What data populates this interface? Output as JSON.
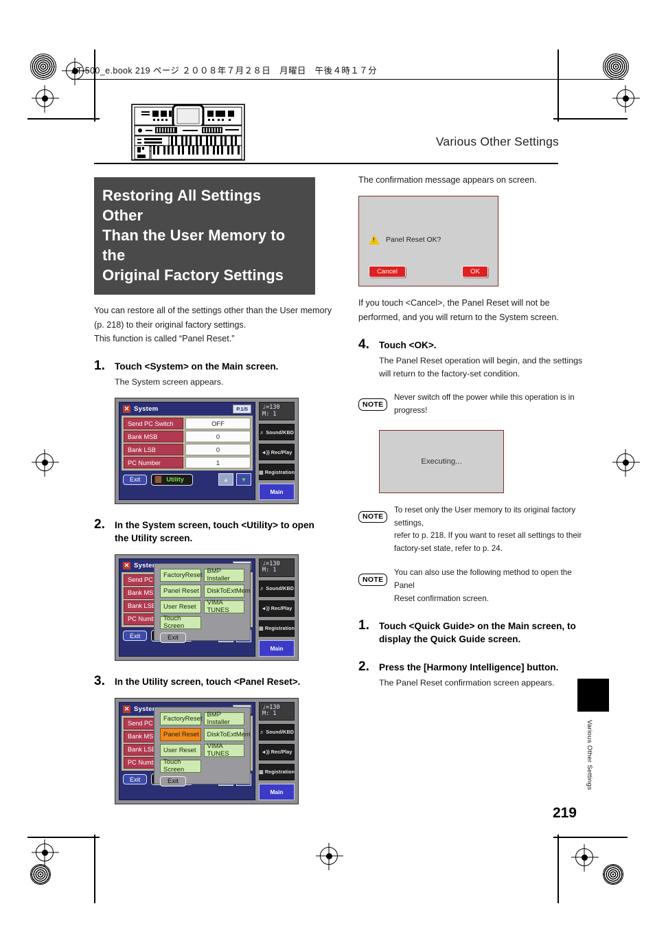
{
  "print_header": {
    "book_line": "AT-500_e.book 219 ページ ２００８年７月２８日　月曜日　午後４時１７分"
  },
  "running_header": {
    "section": "Various Other Settings"
  },
  "illustration": {
    "name": "at-500-organ-front-panel"
  },
  "title": {
    "line1": "Restoring All Settings Other",
    "line2": "Than the User Memory to the",
    "line3": "Original Factory Settings"
  },
  "lead": {
    "l1": "You can restore all of the settings other than the User memory",
    "l2": "(p. 218) to their original factory settings.",
    "l3": "This function is called “Panel Reset.”"
  },
  "steps_left": [
    {
      "num": "1.",
      "head": "Touch <System> on the Main screen.",
      "sub": "The System screen appears."
    },
    {
      "num": "2.",
      "head": "In the System screen, touch <Utility> to open the Utility screen.",
      "sub": ""
    },
    {
      "num": "3.",
      "head": "In the Utility screen, touch <Panel Reset>.",
      "sub": ""
    }
  ],
  "system_screen": {
    "title": "System",
    "close_label": "✕",
    "page_indicator": "P.1/5",
    "rows": [
      {
        "label": "Send PC Switch",
        "value": "OFF"
      },
      {
        "label": "Bank MSB",
        "value": "0"
      },
      {
        "label": "Bank LSB",
        "value": "0"
      },
      {
        "label": "PC Number",
        "value": "1"
      }
    ],
    "exit_label": "Exit",
    "utility_label": "Utility",
    "arrow_up": "▲",
    "arrow_down": "▼"
  },
  "side_panel": {
    "tempo": "♩=130",
    "measure": "M:    1",
    "buttons": [
      {
        "label": "Sound/KBD",
        "icon": "note-icon"
      },
      {
        "label": "Rec/Play",
        "icon": "speaker-icon"
      },
      {
        "label": "Registration",
        "icon": "registration-icon"
      }
    ],
    "main_label": "Main"
  },
  "utility_popup": {
    "buttons": [
      "FactoryReset",
      "BMP Installer",
      "Panel Reset",
      "DiskToExtMem",
      "User Reset",
      "VIMA TUNES",
      "Touch Screen"
    ],
    "exit_label": "Exit",
    "selected": "Panel Reset"
  },
  "right_column": {
    "confirm_intro": "The confirmation message appears on screen.",
    "confirm_dialog": {
      "message": "Panel Reset OK?",
      "cancel_label": "Cancel",
      "ok_label": "OK"
    },
    "cancel_note": {
      "l1": "If you touch <Cancel>, the Panel Reset will not be",
      "l2": "performed, and you will return to the System screen."
    },
    "step4": {
      "num": "4.",
      "head": "Touch <OK>.",
      "sub1": "The Panel Reset operation will begin, and the settings",
      "sub2": "will return to the factory-set condition."
    },
    "note1": {
      "tag": "NOTE",
      "l1": "Never switch off the power while this operation is in",
      "l2": "progress!"
    },
    "exec_dialog": {
      "message": "Executing..."
    },
    "note2": {
      "tag": "NOTE",
      "l1": "To reset only the User memory to its original factory settings,",
      "l2": "refer to p. 218. If you want to reset all settings to their",
      "l3": "factory-set state, refer to p. 24."
    },
    "note3": {
      "tag": "NOTE",
      "l1": "You can also use the following method to open the Panel",
      "l2": "Reset confirmation screen."
    },
    "alt_steps": [
      {
        "num": "1.",
        "head1": "Touch <Quick Guide> on the Main screen, to",
        "head2": "display the Quick Guide screen.",
        "sub": ""
      },
      {
        "num": "2.",
        "head1": "Press the [Harmony Intelligence] button.",
        "head2": "",
        "sub": "The Panel Reset confirmation screen appears."
      }
    ]
  },
  "footer": {
    "page_number": "219",
    "side_tab_text": "Various Other Settings"
  },
  "colors": {
    "banner_bg": "#4a4a4a",
    "lcd_blue": "#2a2f73",
    "row_red": "#b03a52",
    "popup_green": "#cfeab0",
    "selected_orange": "#f08a18",
    "button_red": "#e02020",
    "main_button_blue": "#3b3bc8"
  }
}
